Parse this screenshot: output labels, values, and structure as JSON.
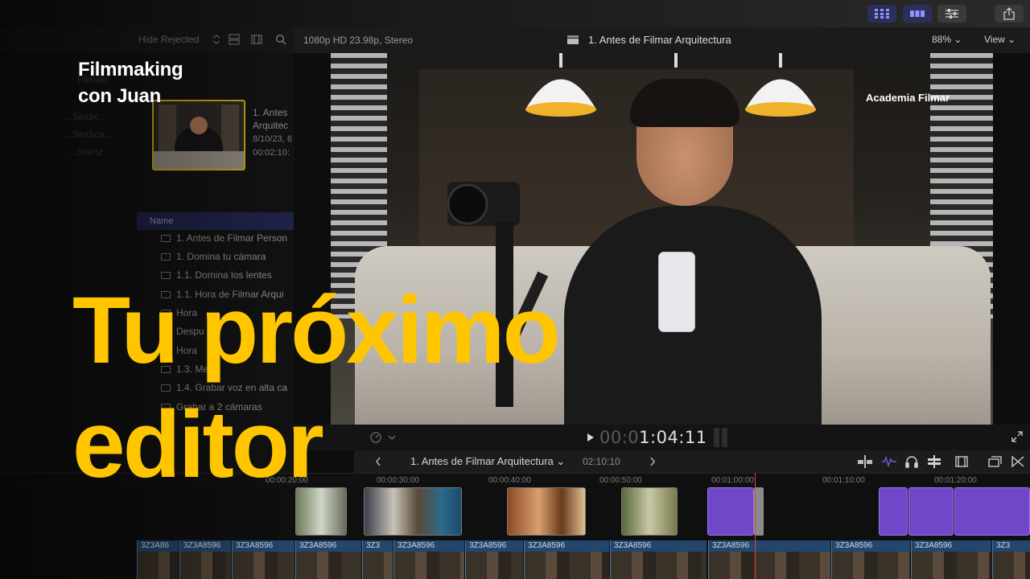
{
  "brand": {
    "line1": "Filmmaking",
    "line2": "con Juan"
  },
  "browser": {
    "filter_label": "Hide Rejected",
    "selected_clip": {
      "title_line1": "1. Antes",
      "title_line2": "Arquitec",
      "date": "8/10/23, 6",
      "duration": "00:02:10:"
    },
    "column_name": "Name",
    "clips": [
      "1. Antes de Filmar Person",
      "1. Domina tu cámara",
      "1.1. Domina los lentes",
      "1.1. Hora de Filmar Arqui",
      "Hora",
      "Despu",
      "Hora",
      "1.3. Mejor",
      "1.4. Grabar voz en alta ca",
      "Grabar a 2 cámaras"
    ],
    "ghost_items": [
      "Filmaki",
      "...Sindic...",
      "...Sindica...",
      "...mienz"
    ]
  },
  "viewer": {
    "format": "1080p HD 23.98p, Stereo",
    "title": "1. Antes de Filmar Arquitectura",
    "zoom": "88%",
    "view_menu": "View",
    "watermark": "Academia Filmar",
    "timecode_dim": "00:0",
    "timecode": "1:04:11"
  },
  "timeline": {
    "project": "1. Antes de Filmar Arquitectura",
    "duration": "02:10:10",
    "ruler": [
      "00:00:20:00",
      "00:00:30:00",
      "00:00:40:00",
      "00:00:50:00",
      "00:01:00:00",
      "00:01:10:00",
      "00:01:20:00"
    ],
    "clip_labels": [
      "3Z3A86",
      "3Z3A8596",
      "3Z3A8596",
      "3Z3A8596",
      "3Z3",
      "3Z3A8596",
      "3Z3A8596",
      "3Z3A8596",
      "3Z3A8596",
      "3Z3A8596",
      "3Z3A8596",
      "3Z3A8596",
      "3Z3A8596",
      "3Z3"
    ]
  },
  "headline": {
    "line1": "Tu próximo",
    "line2": "editor"
  },
  "colors": {
    "headline": "#ffc600",
    "accent_selection": "#c9a114",
    "purple_clip": "#7047c8",
    "video_clip": "#23466d",
    "playhead": "#e04a3a"
  }
}
